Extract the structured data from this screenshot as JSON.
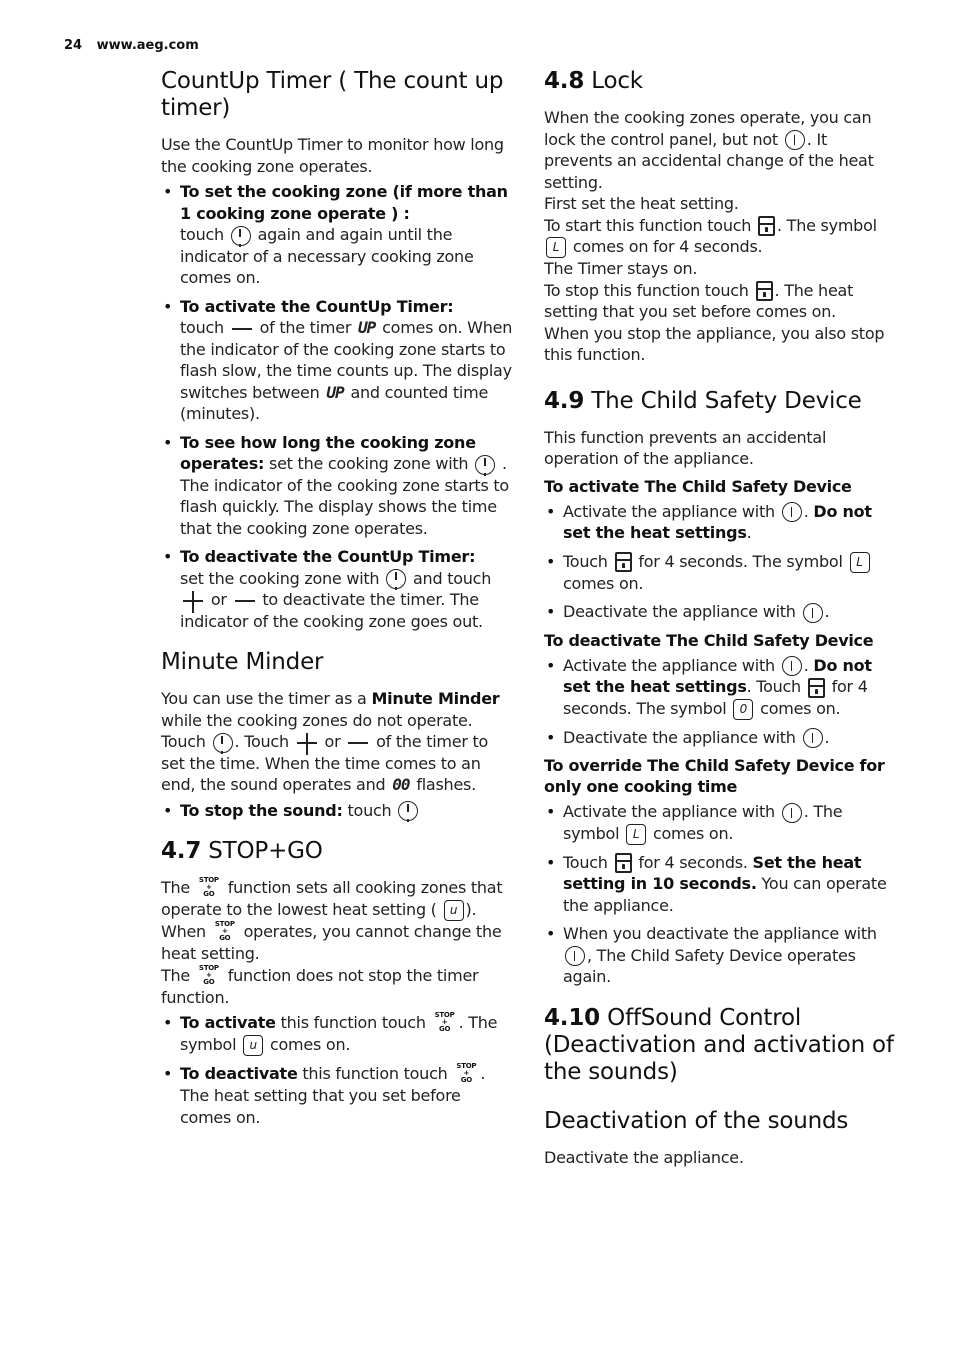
{
  "header": {
    "page_number": "24",
    "website": "www.aeg.com"
  },
  "left": {
    "countup": {
      "title": "CountUp Timer ( The count up timer)",
      "intro": "Use the CountUp Timer to monitor how long the cooking zone operates.",
      "bullets": [
        {
          "bold": "To set the cooking zone (if more than 1 cooking zone operate ) :",
          "t1": "touch",
          "t2": "again and again until the indicator of a necessary cooking zone comes on."
        },
        {
          "bold": "To activate the CountUp Timer:",
          "t1": "touch",
          "t2": "of the timer",
          "seg": "UP",
          "t3": "comes on. When the indicator of the cooking zone starts to flash slow, the time counts up. The display switches between",
          "seg2": "UP",
          "t4": "and counted time (minutes)."
        },
        {
          "bold": "To see how long the cooking zone operates:",
          "t1": "set the cooking zone with",
          "t2": ". The indicator of the cooking zone starts to flash quickly. The display shows the time that the cooking zone operates."
        },
        {
          "bold": "To deactivate the CountUp Timer:",
          "t1": "set the cooking zone with",
          "t2": "and touch",
          "t3": "or",
          "t4": "to deactivate the timer. The indicator of the cooking zone goes out."
        }
      ]
    },
    "minute_minder": {
      "title": "Minute Minder",
      "p1": "You can use the timer as a",
      "p1_bold": "Minute Minder",
      "p2": "while the cooking zones do not operate. Touch",
      "p3": ". Touch",
      "p4": "or",
      "p5": "of the timer to set the time. When the time comes to an end, the sound operates and",
      "seg": "00",
      "p6": "flashes.",
      "bullet_bold": "To stop the sound:",
      "bullet_text": "touch"
    },
    "stopgo": {
      "number": "4.7",
      "title": "STOP+GO",
      "icon_text": {
        "top": "STOP",
        "mid": "+",
        "bot": "GO"
      },
      "l1a": "The",
      "l1b": "function sets all cooking zones that operate to the lowest heat setting (",
      "l1c": ").",
      "symbol_u": "u",
      "l2a": "When",
      "l2b": "operates, you cannot change the heat setting.",
      "l3a": "The",
      "l3b": "function does not stop the timer function.",
      "bullets": [
        {
          "bold": "To activate",
          "t1": "this function touch",
          "t2": ". The symbol",
          "t3": "comes on."
        },
        {
          "bold": "To deactivate",
          "t1": "this function touch",
          "t2": ". The heat setting that you set before comes on."
        }
      ]
    }
  },
  "right": {
    "lock": {
      "number": "4.8",
      "title": "Lock",
      "p1a": "When the cooking zones operate, you can lock the control panel, but not",
      "p1b": ". It prevents an accidental change of the heat setting.",
      "p2": "First set the heat setting.",
      "p3a": "To start this function touch",
      "p3b": ". The symbol",
      "symbol_l": "L",
      "p3c": "comes on for 4 seconds.",
      "p4": "The Timer stays on.",
      "p5a": "To stop this function touch",
      "p5b": ". The heat setting that you set before comes on.",
      "p6": "When you stop the appliance, you also stop this function."
    },
    "child": {
      "number": "4.9",
      "title": "The Child Safety Device",
      "intro": "This function prevents an accidental operation of the appliance.",
      "activate_heading": "To activate The Child Safety Device",
      "activate": [
        {
          "t1": "Activate the appliance with",
          "t2": ".",
          "bold": "Do not set the heat settings",
          "t3": "."
        },
        {
          "t1": "Touch",
          "t2": "for 4 seconds. The symbol",
          "symbol": "L",
          "t3": "comes on."
        },
        {
          "t1": "Deactivate the appliance with",
          "t2": "."
        }
      ],
      "deactivate_heading": "To deactivate The Child Safety Device",
      "deactivate": [
        {
          "t1": "Activate the appliance with",
          "t2": ".",
          "bold": "Do not set the heat settings",
          "t3": ". Touch",
          "t4": "for 4 seconds. The symbol",
          "symbol": "0",
          "t5": "comes on."
        },
        {
          "t1": "Deactivate the appliance with",
          "t2": "."
        }
      ],
      "override_heading": "To override The Child Safety Device for only one cooking time",
      "override": [
        {
          "t1": "Activate the appliance with",
          "t2": ". The symbol",
          "symbol": "L",
          "t3": "comes on."
        },
        {
          "t1": "Touch",
          "t2": "for 4 seconds.",
          "bold": "Set the heat setting in 10 seconds.",
          "t3": "You can operate the appliance."
        },
        {
          "t1": "When you deactivate the appliance with",
          "t2": ", The Child Safety Device operates again."
        }
      ]
    },
    "offsound": {
      "number": "4.10",
      "title": "OffSound Control (Deactivation and activation of the sounds)",
      "sub_title": "Deactivation of the sounds",
      "text": "Deactivate the appliance."
    }
  }
}
